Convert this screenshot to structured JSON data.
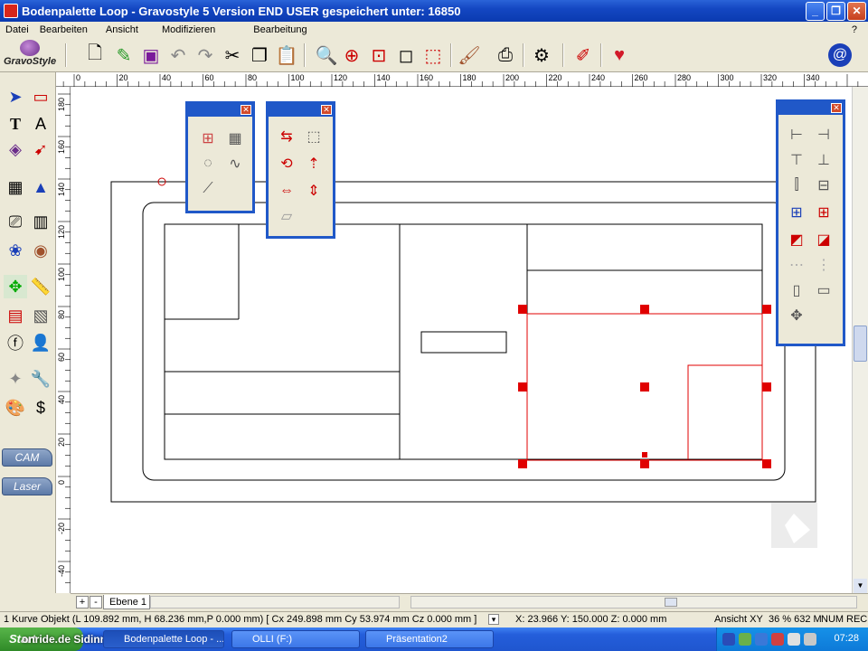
{
  "window": {
    "title": "Bodenpalette Loop - Gravostyle 5  Version END USER gespeichert unter: 16850",
    "minimize": "_",
    "maximize": "❐",
    "close": "✕"
  },
  "menu": {
    "items": [
      "Datei",
      "Bearbeiten",
      "Ansicht",
      "Modifizieren",
      "Bearbeitung"
    ],
    "help": "?"
  },
  "logo": "GravoStyle",
  "ruler": {
    "top_labels": [
      "20",
      "0",
      "20",
      "40",
      "60",
      "80",
      "100",
      "120",
      "140",
      "160",
      "180",
      "200",
      "220",
      "240",
      "260",
      "280",
      "300",
      "320",
      "340"
    ],
    "left_labels": [
      "180",
      "160",
      "140",
      "120",
      "100",
      "80",
      "60",
      "40",
      "20",
      "0",
      "-20",
      "-40"
    ]
  },
  "toolbox": {
    "cam_label": "CAM",
    "laser_label": "Laser"
  },
  "layers": {
    "add": "+",
    "remove": "-",
    "current": "Ebene 1"
  },
  "status": {
    "object_info": "1 Kurve Objekt (L 109.892 mm, H 68.236 mm,P 0.000 mm) [ Cx 249.898 mm  Cy 53.974 mm  Cz 0.000 mm ]",
    "coords": "X: 23.966   Y: 150.000   Z: 0.000 mm",
    "view": "Ansicht XY",
    "zoom": "36 % 632 M",
    "num": "NUM",
    "rec": "REC"
  },
  "taskbar": {
    "start": "Start",
    "watermark": "onride.de   Sidinn",
    "tasks": [
      "Bodenpalette Loop - ...",
      "OLLI (F:)",
      "Präsentation2"
    ],
    "clock": "07:28"
  },
  "colors": {
    "selection": "#e00000",
    "title_blue": "#1447c2",
    "palette_border": "#2058c8"
  }
}
